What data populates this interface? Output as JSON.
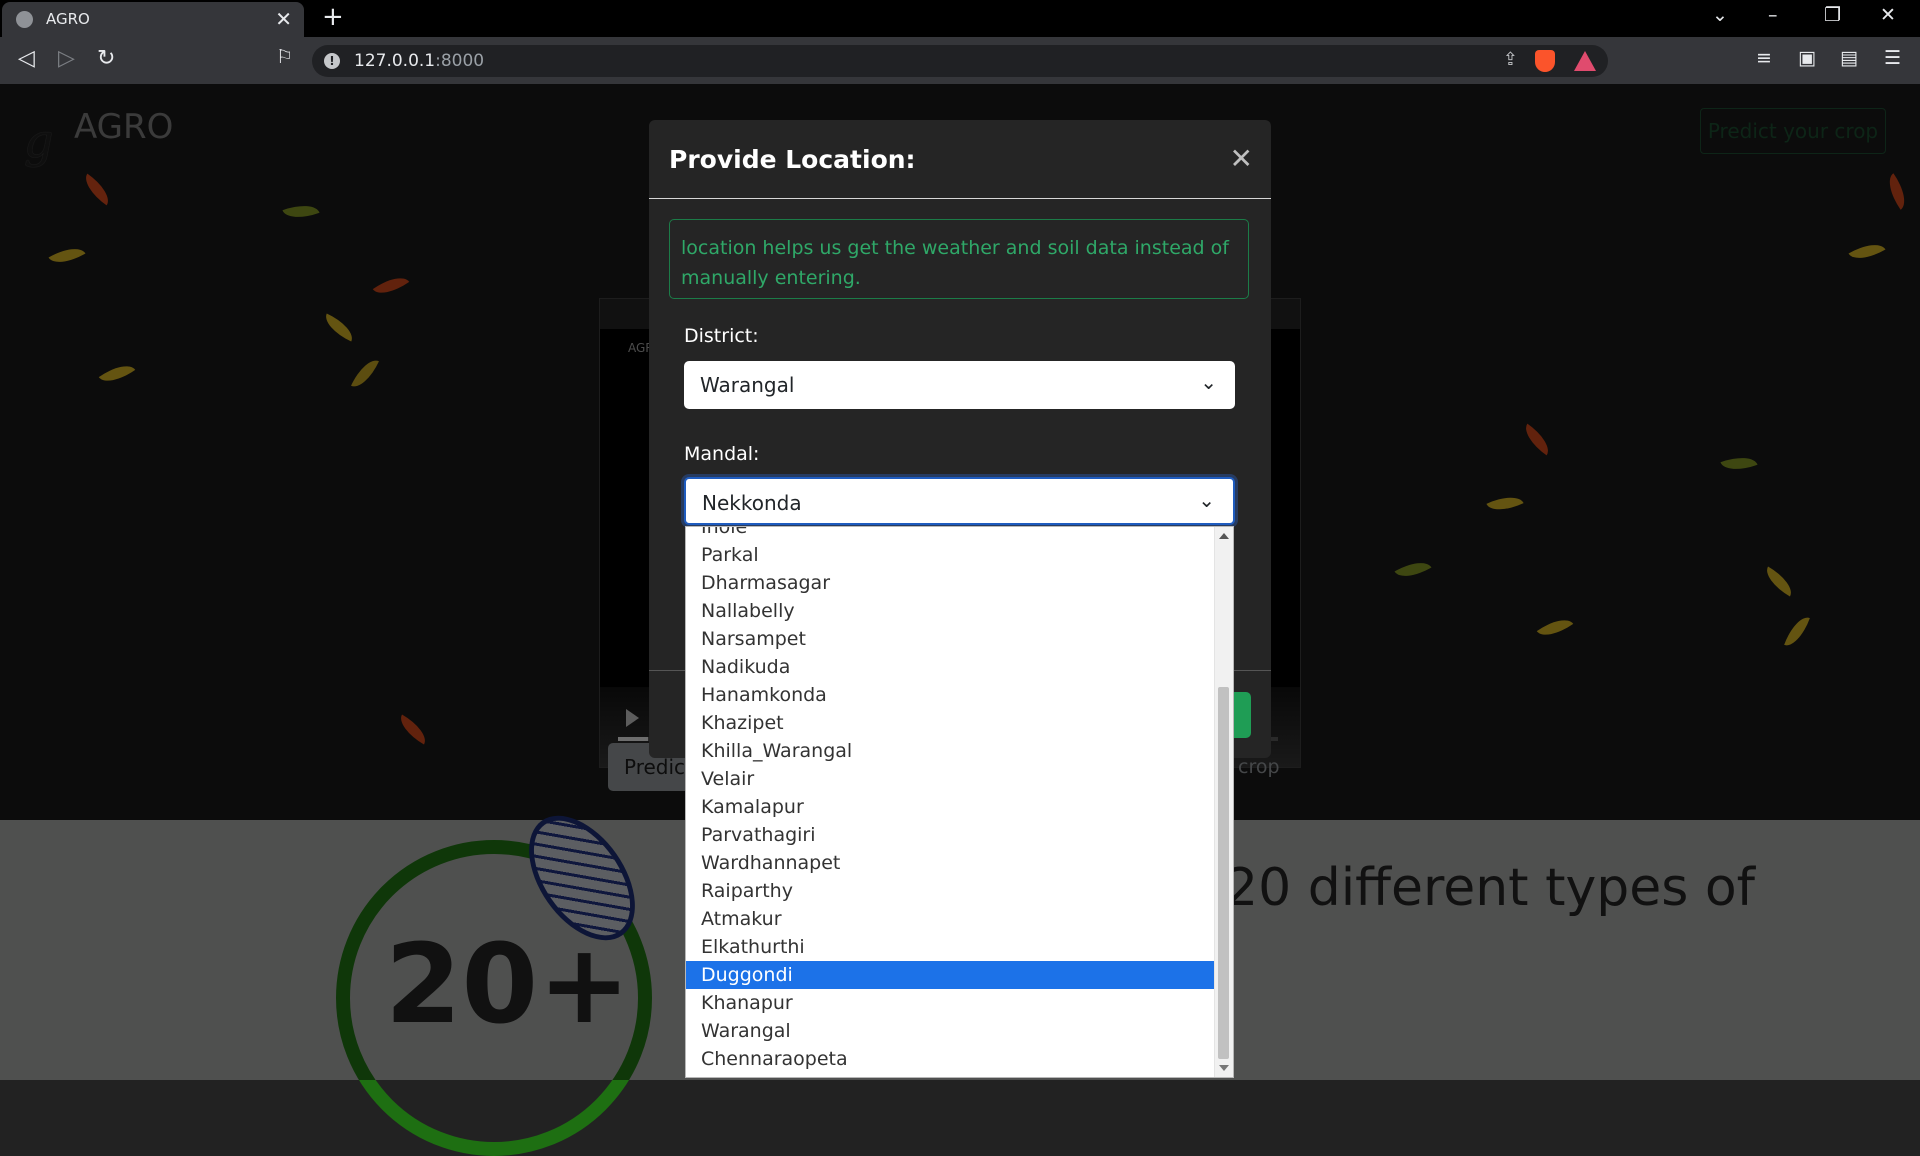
{
  "browser": {
    "tab_title": "AGRO",
    "url_host": "127.0.0.1",
    "url_port": ":8000"
  },
  "page": {
    "logo_text": "AGRO",
    "nav_predict_button": "Predict your crop",
    "video_mini_text": "AGRO",
    "hero_button_left": "Predict",
    "hero_button_right_fragment": "crop",
    "stat_number": "20+",
    "lower_heading_fragment": "20 different types of"
  },
  "modal": {
    "title": "Provide Location:",
    "alert_text": "location helps us get the weather and soil data instead of manually entering.",
    "district_label": "District:",
    "district_value": "Warangal",
    "mandal_label": "Mandal:",
    "mandal_value": "Nekkonda",
    "mandal_options": [
      "Inole",
      "Parkal",
      "Dharmasagar",
      "Nallabelly",
      "Narsampet",
      "Nadikuda",
      "Hanamkonda",
      "Khazipet",
      "Khilla_Warangal",
      "Velair",
      "Kamalapur",
      "Parvathagiri",
      "Wardhannapet",
      "Raiparthy",
      "Atmakur",
      "Elkathurthi",
      "Duggondi",
      "Khanapur",
      "Warangal",
      "Chennaraopeta"
    ],
    "highlighted_option": "Duggondi"
  },
  "icons": {
    "close": "close-icon",
    "chevron": "chevron-down-icon"
  },
  "colors": {
    "accent_green": "#1f9d55",
    "highlight_blue": "#1c72e8",
    "alert_green": "#2fa868"
  }
}
